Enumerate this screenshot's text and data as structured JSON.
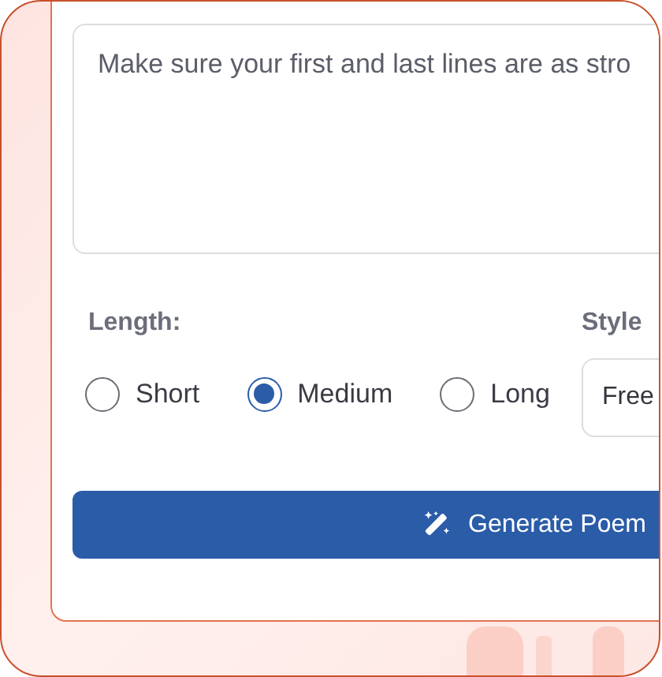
{
  "prompt_field": {
    "placeholder": "Make sure your first and last lines are as stro"
  },
  "length": {
    "label": "Length:",
    "options": [
      {
        "label": "Short",
        "selected": false
      },
      {
        "label": "Medium",
        "selected": true
      },
      {
        "label": "Long",
        "selected": false
      }
    ]
  },
  "style": {
    "label": "Style",
    "value": "Free"
  },
  "generate_button": {
    "label": "Generate Poem"
  }
}
